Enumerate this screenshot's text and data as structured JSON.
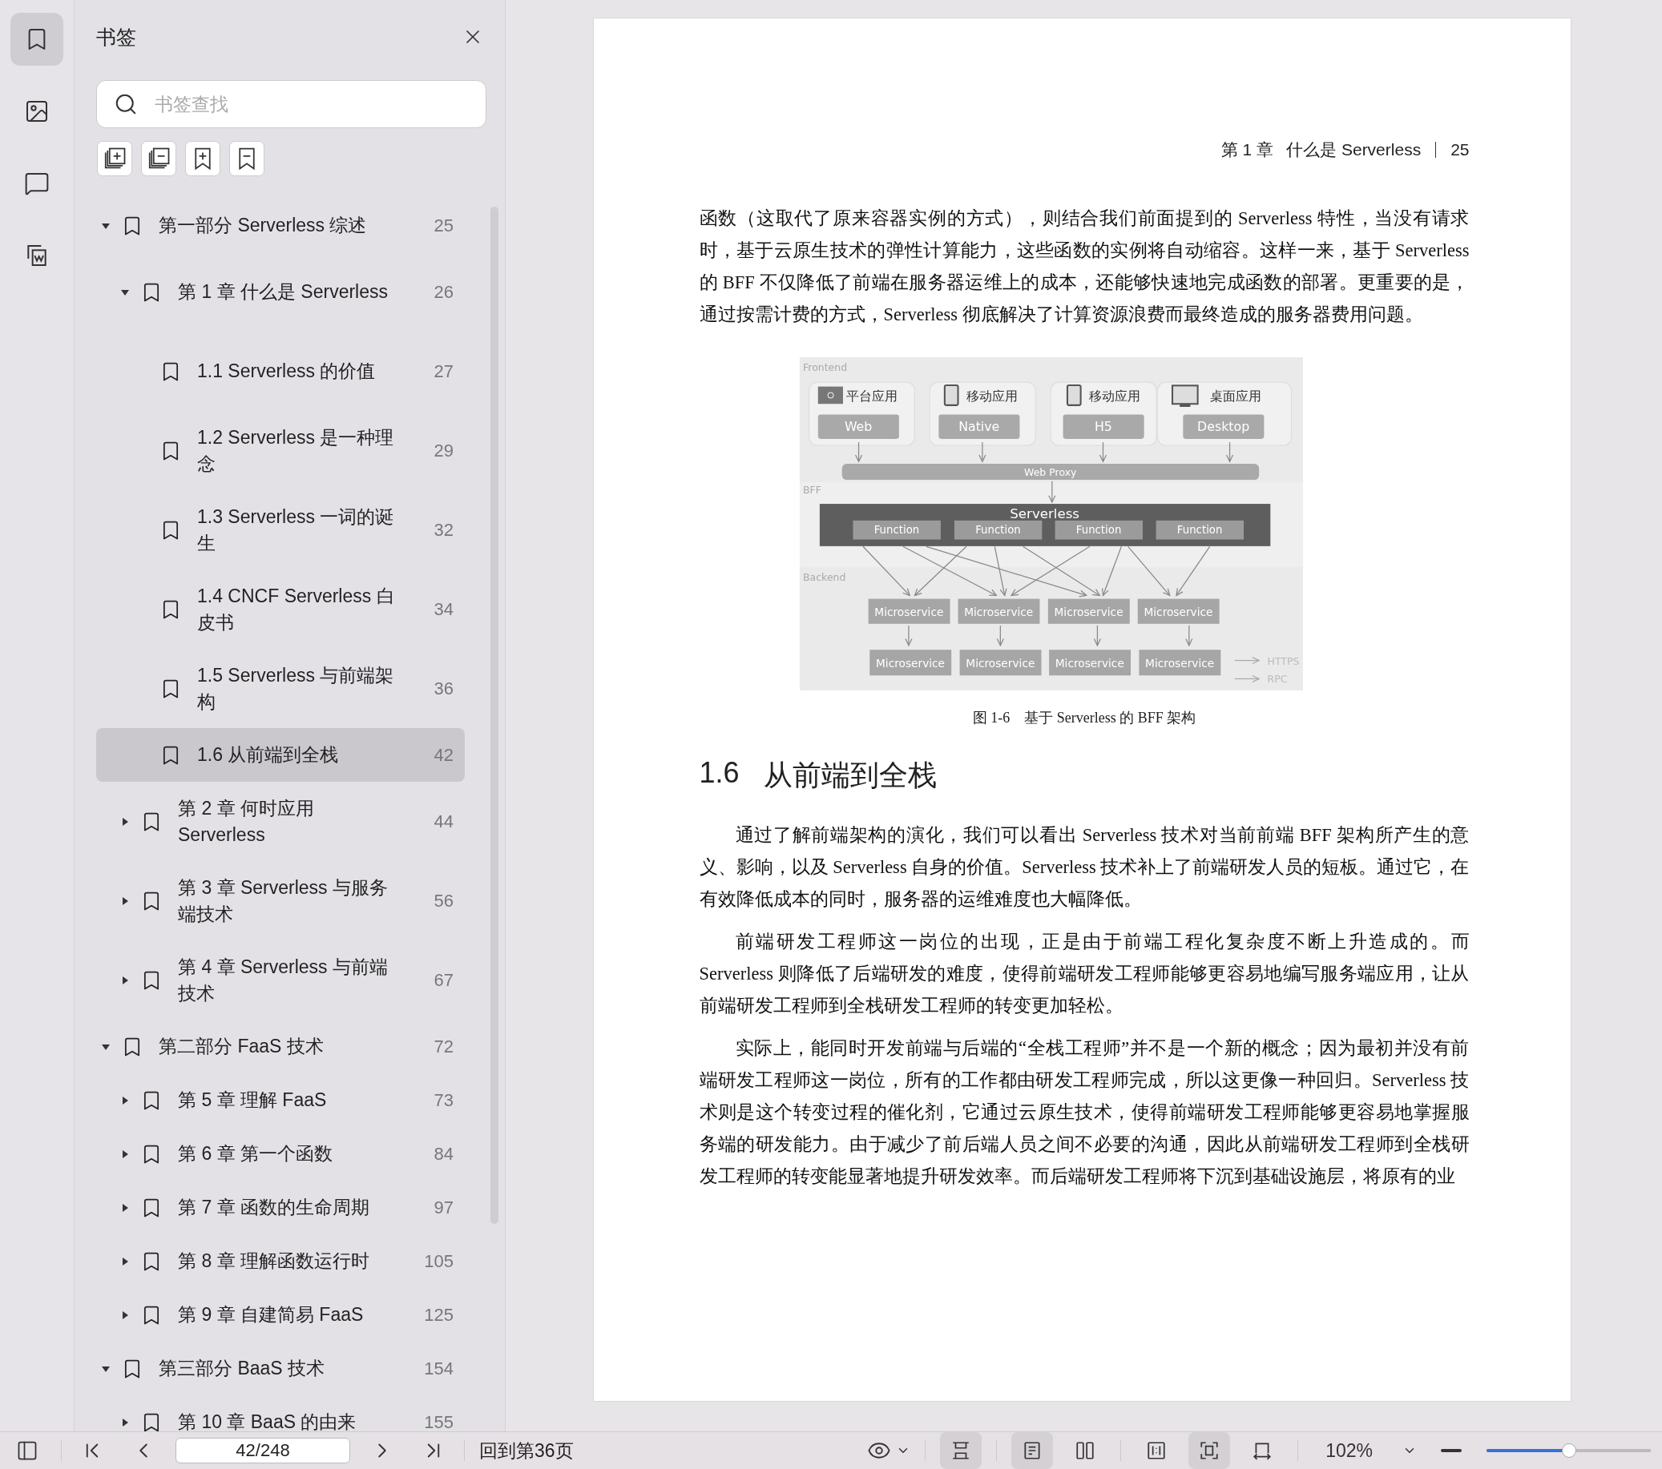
{
  "rail": [
    {
      "selected": true
    },
    {
      "selected": false
    },
    {
      "selected": false
    },
    {
      "selected": false
    }
  ],
  "bookmarks": {
    "title": "书签",
    "search": {
      "placeholder": "书签查找"
    },
    "items": [
      {
        "title": "第一部分 Serverless 综述",
        "page": "25",
        "expanded": true,
        "selected": false,
        "children": [
          {
            "title": "第 1 章 什么是 Serverless",
            "page": "26",
            "expanded": true,
            "selected": false,
            "children": [
              {
                "title": "1.1 Serverless 的价值",
                "page": "27",
                "selected": false
              },
              {
                "title": "1.2 Serverless 是一种理念",
                "page": "29",
                "selected": false
              },
              {
                "title": "1.3 Serverless 一词的诞生",
                "page": "32",
                "selected": false
              },
              {
                "title": "1.4 CNCF Serverless 白皮书",
                "page": "34",
                "selected": false
              },
              {
                "title": "1.5 Serverless 与前端架构",
                "page": "36",
                "selected": false
              },
              {
                "title": "1.6 从前端到全栈",
                "page": "42",
                "selected": true
              }
            ]
          },
          {
            "title": "第 2 章 何时应用 Serverless",
            "page": "44",
            "expanded": false,
            "selected": false
          },
          {
            "title": "第 3 章 Serverless 与服务端技术",
            "page": "56",
            "expanded": false,
            "selected": false
          },
          {
            "title": "第 4 章 Serverless 与前端技术",
            "page": "67",
            "expanded": false,
            "selected": false
          }
        ]
      },
      {
        "title": "第二部分 FaaS 技术",
        "page": "72",
        "expanded": true,
        "selected": false,
        "children": [
          {
            "title": "第 5 章 理解 FaaS",
            "page": "73",
            "expanded": false,
            "selected": false
          },
          {
            "title": "第 6 章 第一个函数",
            "page": "84",
            "expanded": false,
            "selected": false
          },
          {
            "title": "第 7 章 函数的生命周期",
            "page": "97",
            "expanded": false,
            "selected": false
          },
          {
            "title": "第 8 章 理解函数运行时",
            "page": "105",
            "expanded": false,
            "selected": false
          },
          {
            "title": "第 9 章 自建简易 FaaS",
            "page": "125",
            "expanded": false,
            "selected": false
          }
        ]
      },
      {
        "title": "第三部分 BaaS 技术",
        "page": "154",
        "expanded": true,
        "selected": false,
        "children": [
          {
            "title": "第 10 章 BaaS 的由来",
            "page": "155",
            "expanded": false,
            "selected": false
          }
        ]
      }
    ]
  },
  "page": {
    "header": {
      "chapter": "第 1 章",
      "title": "什么是 Serverless",
      "number": "25"
    },
    "paragraph_1": "函数（这取代了原来容器实例的方式），则结合我们前面提到的 Serverless 特性，当没有请求时，基于云原生技术的弹性计算能力，这些函数的实例将自动缩容。这样一来，基于 Serverless 的 BFF 不仅降低了前端在服务器运维上的成本，还能够快速地完成函数的部署。更重要的是，通过按需计费的方式，Serverless 彻底解决了计算资源浪费而最终造成的服务器费用问题。",
    "figure": {
      "sections": [
        "Frontend",
        "BFF",
        "Backend"
      ],
      "clients": [
        {
          "label": "平台应用",
          "button": "Web"
        },
        {
          "label": "移动应用",
          "button": "Native"
        },
        {
          "label": "移动应用",
          "button": "H5"
        },
        {
          "label": "桌面应用",
          "button": "Desktop"
        }
      ],
      "proxy": "Web Proxy",
      "serverless": "Serverless",
      "functions": [
        "Function",
        "Function",
        "Function",
        "Function"
      ],
      "microservices_row_1": [
        "Microservice",
        "Microservice",
        "Microservice",
        "Microservice"
      ],
      "microservices_row_2": [
        "Microservice",
        "Microservice",
        "Microservice",
        "Microservice"
      ],
      "legend": [
        "HTTPS",
        "RPC"
      ]
    },
    "caption": "图 1-6　基于 Serverless 的 BFF 架构",
    "section": {
      "number": "1.6",
      "title": "从前端到全栈"
    },
    "paragraphs": [
      "通过了解前端架构的演化，我们可以看出 Serverless 技术对当前前端 BFF 架构所产生的意义、影响，以及 Serverless 自身的价值。Serverless 技术补上了前端研发人员的短板。通过它，在有效降低成本的同时，服务器的运维难度也大幅降低。",
      "前端研发工程师这一岗位的出现，正是由于前端工程化复杂度不断上升造成的。而 Serverless 则降低了后端研发的难度，使得前端研发工程师能够更容易地编写服务端应用，让从前端研发工程师到全栈研发工程师的转变更加轻松。",
      "实际上，能同时开发前端与后端的“全栈工程师”并不是一个新的概念；因为最初并没有前端研发工程师这一岗位，所有的工作都由研发工程师完成，所以这更像一种回归。Serverless 技术则是这个转变过程的催化剂，它通过云原生技术，使得前端研发工程师能够更容易地掌握服务端的研发能力。由于减少了前后端人员之间不必要的沟通，因此从前端研发工程师到全栈研发工程师的转变能显著地提升研发效率。而后端研发工程师将下沉到基础设施层，将原有的业"
    ]
  },
  "toolbar": {
    "page_field": "42/248",
    "back_link": "回到第36页",
    "view_buttons": [
      {
        "selected": true
      },
      {
        "selected": true
      },
      {
        "selected": false
      },
      {
        "selected": false
      },
      {
        "selected": true
      },
      {
        "selected": false
      }
    ],
    "zoom": "102%",
    "zoom_slider": {
      "level": 0.5
    }
  }
}
